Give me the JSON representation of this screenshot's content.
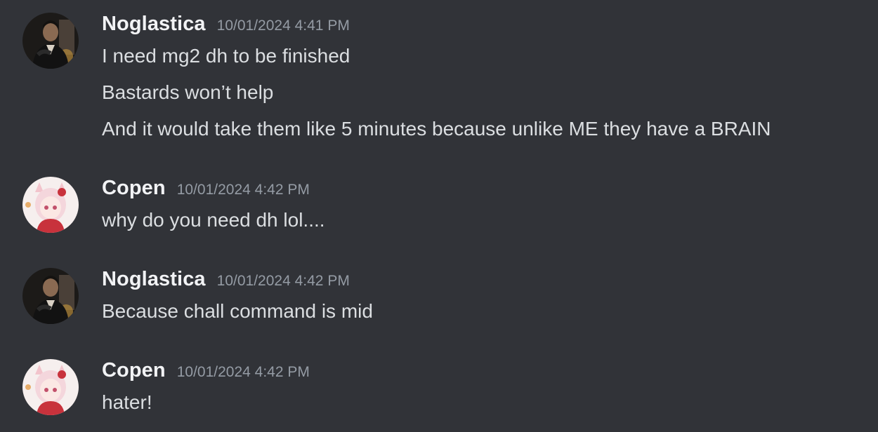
{
  "colors": {
    "background": "#313338",
    "username": "#f2f3f5",
    "timestamp": "#949ba4",
    "text": "#dbdee1"
  },
  "messages": [
    {
      "author": "Noglastica",
      "timestamp": "10/01/2024 4:41 PM",
      "avatar_icon": "man-in-suit-avatar",
      "lines": [
        "I need mg2 dh to be finished",
        "Bastards won’t help",
        "And it would take them like 5 minutes because unlike ME they have a BRAIN"
      ]
    },
    {
      "author": "Copen",
      "timestamp": "10/01/2024 4:42 PM",
      "avatar_icon": "anime-girl-avatar",
      "lines": [
        "why do you need dh lol...."
      ]
    },
    {
      "author": "Noglastica",
      "timestamp": "10/01/2024 4:42 PM",
      "avatar_icon": "man-in-suit-avatar",
      "lines": [
        "Because chall command is mid"
      ]
    },
    {
      "author": "Copen",
      "timestamp": "10/01/2024 4:42 PM",
      "avatar_icon": "anime-girl-avatar",
      "lines": [
        "hater!"
      ]
    }
  ]
}
